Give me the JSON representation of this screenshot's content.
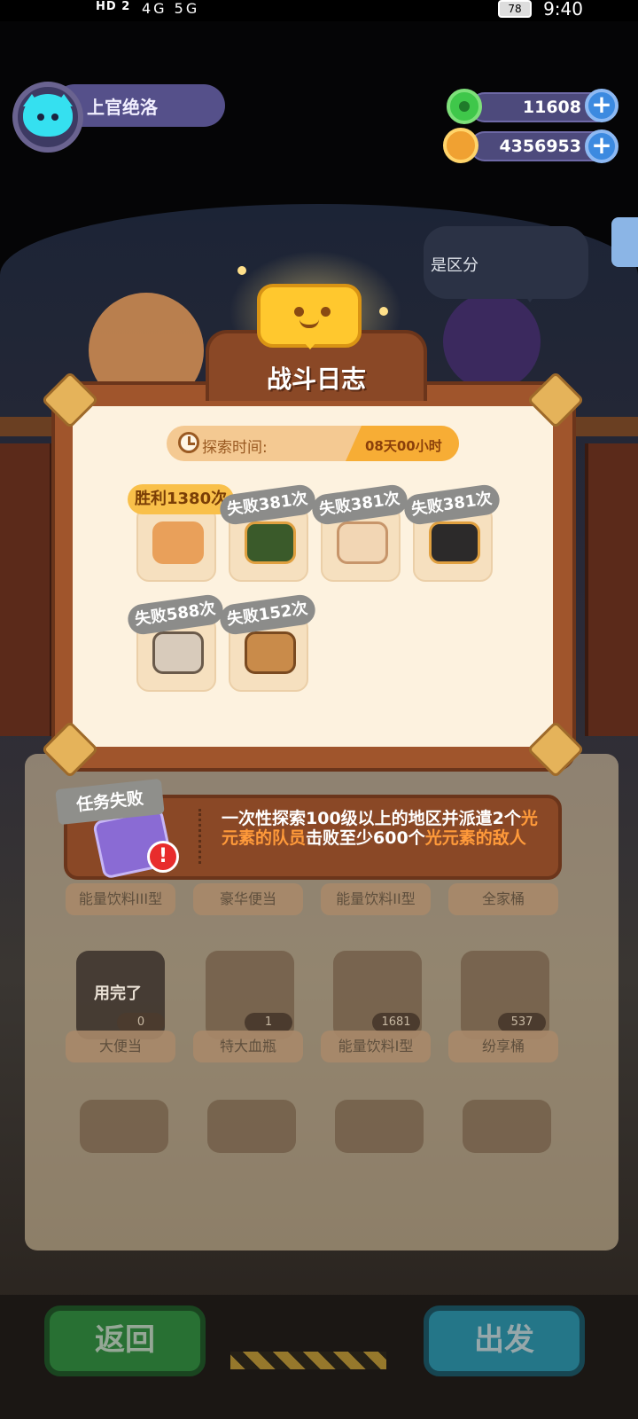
{
  "status_bar": {
    "left_indicators": "HD 2",
    "signal_icons": "4G 5G",
    "battery": "78",
    "time": "9:40"
  },
  "player": {
    "name": "上官绝洛"
  },
  "currencies": [
    {
      "icon": "green-gem-icon",
      "value": "11608"
    },
    {
      "icon": "gold-planet-coin-icon",
      "value": "4356953"
    }
  ],
  "npc_speech": "是区分",
  "battle_log": {
    "title": "战斗日志",
    "explore_time_label": "探索时间:",
    "explore_time_value": "08天00小时",
    "results": [
      {
        "badge": "胜利1380次",
        "type": "win",
        "color": "#f9c04a"
      },
      {
        "badge": "失败381次",
        "type": "lose",
        "color": "#8c8c8a"
      },
      {
        "badge": "失败381次",
        "type": "lose",
        "color": "#8c8c8a"
      },
      {
        "badge": "失败381次",
        "type": "lose",
        "color": "#8c8c8a"
      },
      {
        "badge": "失败588次",
        "type": "lose",
        "color": "#8c8c8a"
      },
      {
        "badge": "失败152次",
        "type": "lose",
        "color": "#8c8c8a"
      }
    ]
  },
  "mission": {
    "tag": "任务失败",
    "text_1": "一次性探索100级以上的地区并派遣2个",
    "text_hl_1": "光元素的队员",
    "text_2": "击败至少600个",
    "text_hl_2": "光元素的敌人",
    "highlight_color": "#ff9a3a"
  },
  "inventory": {
    "row1_labels": [
      "能量饮料III型",
      "豪华便当",
      "能量饮料II型",
      "全家桶"
    ],
    "row2": [
      {
        "label": "大便当",
        "count": "0",
        "status": "用完了"
      },
      {
        "label": "特大血瓶",
        "count": "1"
      },
      {
        "label": "能量饮料I型",
        "count": "1681"
      },
      {
        "label": "纷享桶",
        "count": "537"
      }
    ]
  },
  "buttons": {
    "back": "返回",
    "depart": "出发"
  }
}
